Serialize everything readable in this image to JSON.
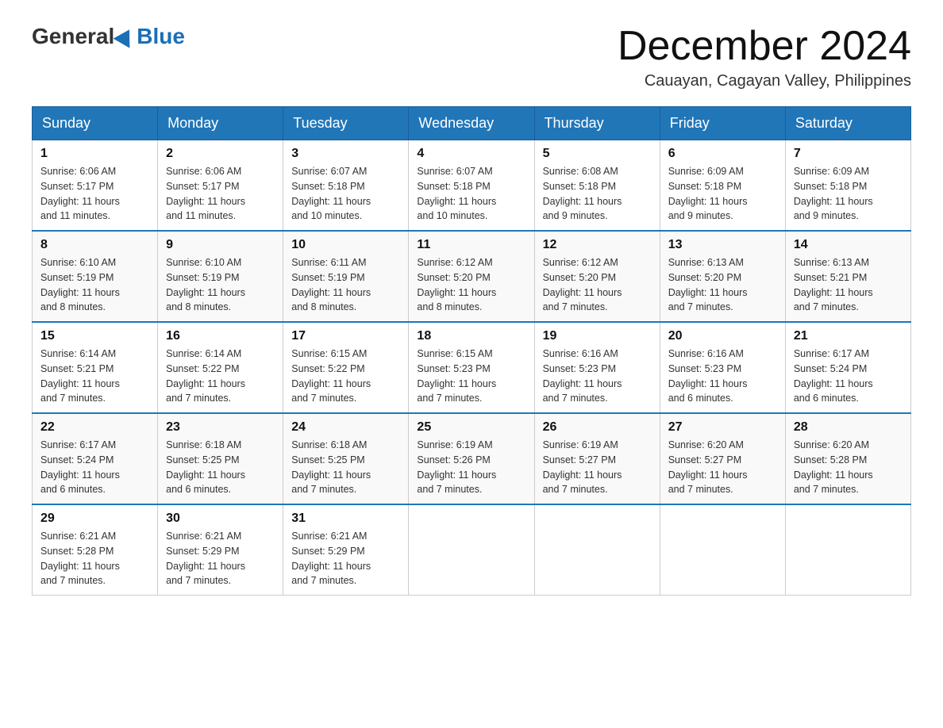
{
  "logo": {
    "general": "General",
    "blue": "Blue"
  },
  "title": {
    "month": "December 2024",
    "location": "Cauayan, Cagayan Valley, Philippines"
  },
  "weekdays": [
    "Sunday",
    "Monday",
    "Tuesday",
    "Wednesday",
    "Thursday",
    "Friday",
    "Saturday"
  ],
  "weeks": [
    [
      {
        "day": "1",
        "sunrise": "6:06 AM",
        "sunset": "5:17 PM",
        "daylight": "11 hours and 11 minutes."
      },
      {
        "day": "2",
        "sunrise": "6:06 AM",
        "sunset": "5:17 PM",
        "daylight": "11 hours and 11 minutes."
      },
      {
        "day": "3",
        "sunrise": "6:07 AM",
        "sunset": "5:18 PM",
        "daylight": "11 hours and 10 minutes."
      },
      {
        "day": "4",
        "sunrise": "6:07 AM",
        "sunset": "5:18 PM",
        "daylight": "11 hours and 10 minutes."
      },
      {
        "day": "5",
        "sunrise": "6:08 AM",
        "sunset": "5:18 PM",
        "daylight": "11 hours and 9 minutes."
      },
      {
        "day": "6",
        "sunrise": "6:09 AM",
        "sunset": "5:18 PM",
        "daylight": "11 hours and 9 minutes."
      },
      {
        "day": "7",
        "sunrise": "6:09 AM",
        "sunset": "5:18 PM",
        "daylight": "11 hours and 9 minutes."
      }
    ],
    [
      {
        "day": "8",
        "sunrise": "6:10 AM",
        "sunset": "5:19 PM",
        "daylight": "11 hours and 8 minutes."
      },
      {
        "day": "9",
        "sunrise": "6:10 AM",
        "sunset": "5:19 PM",
        "daylight": "11 hours and 8 minutes."
      },
      {
        "day": "10",
        "sunrise": "6:11 AM",
        "sunset": "5:19 PM",
        "daylight": "11 hours and 8 minutes."
      },
      {
        "day": "11",
        "sunrise": "6:12 AM",
        "sunset": "5:20 PM",
        "daylight": "11 hours and 8 minutes."
      },
      {
        "day": "12",
        "sunrise": "6:12 AM",
        "sunset": "5:20 PM",
        "daylight": "11 hours and 7 minutes."
      },
      {
        "day": "13",
        "sunrise": "6:13 AM",
        "sunset": "5:20 PM",
        "daylight": "11 hours and 7 minutes."
      },
      {
        "day": "14",
        "sunrise": "6:13 AM",
        "sunset": "5:21 PM",
        "daylight": "11 hours and 7 minutes."
      }
    ],
    [
      {
        "day": "15",
        "sunrise": "6:14 AM",
        "sunset": "5:21 PM",
        "daylight": "11 hours and 7 minutes."
      },
      {
        "day": "16",
        "sunrise": "6:14 AM",
        "sunset": "5:22 PM",
        "daylight": "11 hours and 7 minutes."
      },
      {
        "day": "17",
        "sunrise": "6:15 AM",
        "sunset": "5:22 PM",
        "daylight": "11 hours and 7 minutes."
      },
      {
        "day": "18",
        "sunrise": "6:15 AM",
        "sunset": "5:23 PM",
        "daylight": "11 hours and 7 minutes."
      },
      {
        "day": "19",
        "sunrise": "6:16 AM",
        "sunset": "5:23 PM",
        "daylight": "11 hours and 7 minutes."
      },
      {
        "day": "20",
        "sunrise": "6:16 AM",
        "sunset": "5:23 PM",
        "daylight": "11 hours and 6 minutes."
      },
      {
        "day": "21",
        "sunrise": "6:17 AM",
        "sunset": "5:24 PM",
        "daylight": "11 hours and 6 minutes."
      }
    ],
    [
      {
        "day": "22",
        "sunrise": "6:17 AM",
        "sunset": "5:24 PM",
        "daylight": "11 hours and 6 minutes."
      },
      {
        "day": "23",
        "sunrise": "6:18 AM",
        "sunset": "5:25 PM",
        "daylight": "11 hours and 6 minutes."
      },
      {
        "day": "24",
        "sunrise": "6:18 AM",
        "sunset": "5:25 PM",
        "daylight": "11 hours and 7 minutes."
      },
      {
        "day": "25",
        "sunrise": "6:19 AM",
        "sunset": "5:26 PM",
        "daylight": "11 hours and 7 minutes."
      },
      {
        "day": "26",
        "sunrise": "6:19 AM",
        "sunset": "5:27 PM",
        "daylight": "11 hours and 7 minutes."
      },
      {
        "day": "27",
        "sunrise": "6:20 AM",
        "sunset": "5:27 PM",
        "daylight": "11 hours and 7 minutes."
      },
      {
        "day": "28",
        "sunrise": "6:20 AM",
        "sunset": "5:28 PM",
        "daylight": "11 hours and 7 minutes."
      }
    ],
    [
      {
        "day": "29",
        "sunrise": "6:21 AM",
        "sunset": "5:28 PM",
        "daylight": "11 hours and 7 minutes."
      },
      {
        "day": "30",
        "sunrise": "6:21 AM",
        "sunset": "5:29 PM",
        "daylight": "11 hours and 7 minutes."
      },
      {
        "day": "31",
        "sunrise": "6:21 AM",
        "sunset": "5:29 PM",
        "daylight": "11 hours and 7 minutes."
      },
      null,
      null,
      null,
      null
    ]
  ],
  "labels": {
    "sunrise": "Sunrise:",
    "sunset": "Sunset:",
    "daylight": "Daylight:"
  }
}
